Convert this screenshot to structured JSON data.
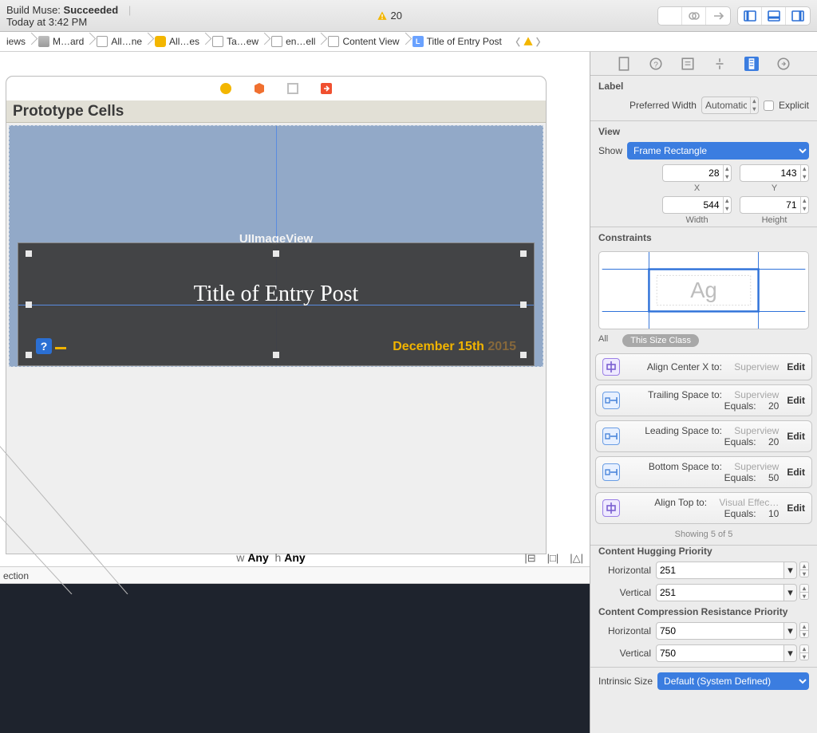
{
  "toolbar": {
    "build_label": "Build Muse:",
    "build_status": "Succeeded",
    "build_time": "Today at 3:42 PM",
    "warning_count": "20"
  },
  "jumpbar": {
    "items": [
      "iews",
      "M…ard",
      "All…ne",
      "All…es",
      "Ta…ew",
      "en…ell",
      "Content View",
      "Title of Entry Post"
    ]
  },
  "canvas": {
    "prototype_header": "Prototype Cells",
    "uiimage_label": "UIImageView",
    "title_label": "Title of Entry Post",
    "date_main": "December 15th",
    "date_year": "2015",
    "size_w_label": "w",
    "size_w_value": "Any",
    "size_h_label": "h",
    "size_h_value": "Any",
    "issues_text": "ection"
  },
  "inspector": {
    "label_section": "Label",
    "pref_width_label": "Preferred Width",
    "pref_width_value": "Automatic",
    "explicit_label": "Explicit",
    "view_section": "View",
    "show_label": "Show",
    "show_value": "Frame Rectangle",
    "x": "28",
    "y": "143",
    "x_label": "X",
    "y_label": "Y",
    "width": "544",
    "height": "71",
    "width_label": "Width",
    "height_label": "Height",
    "constraints_section": "Constraints",
    "cp_ag": "Ag",
    "tab_all": "All",
    "tab_size": "This Size Class",
    "constraints": [
      {
        "line1_l": "Align Center X to:",
        "line1_r": "Superview",
        "line2_l": "",
        "line2_r": "",
        "icon": "center"
      },
      {
        "line1_l": "Trailing Space to:",
        "line1_r": "Superview",
        "line2_l": "Equals:",
        "line2_r": "20",
        "icon": "h"
      },
      {
        "line1_l": "Leading Space to:",
        "line1_r": "Superview",
        "line2_l": "Equals:",
        "line2_r": "20",
        "icon": "h"
      },
      {
        "line1_l": "Bottom Space to:",
        "line1_r": "Superview",
        "line2_l": "Equals:",
        "line2_r": "50",
        "icon": "h"
      },
      {
        "line1_l": "Align Top to:",
        "line1_r": "Visual Effec…",
        "line2_l": "Equals:",
        "line2_r": "10",
        "icon": "center"
      }
    ],
    "edit_label": "Edit",
    "showing": "Showing 5 of 5",
    "hug_title": "Content Hugging Priority",
    "comp_title": "Content Compression Resistance Priority",
    "horiz_label": "Horizontal",
    "vert_label": "Vertical",
    "hug_h": "251",
    "hug_v": "251",
    "comp_h": "750",
    "comp_v": "750",
    "intrinsic_label": "Intrinsic Size",
    "intrinsic_value": "Default (System Defined)"
  }
}
